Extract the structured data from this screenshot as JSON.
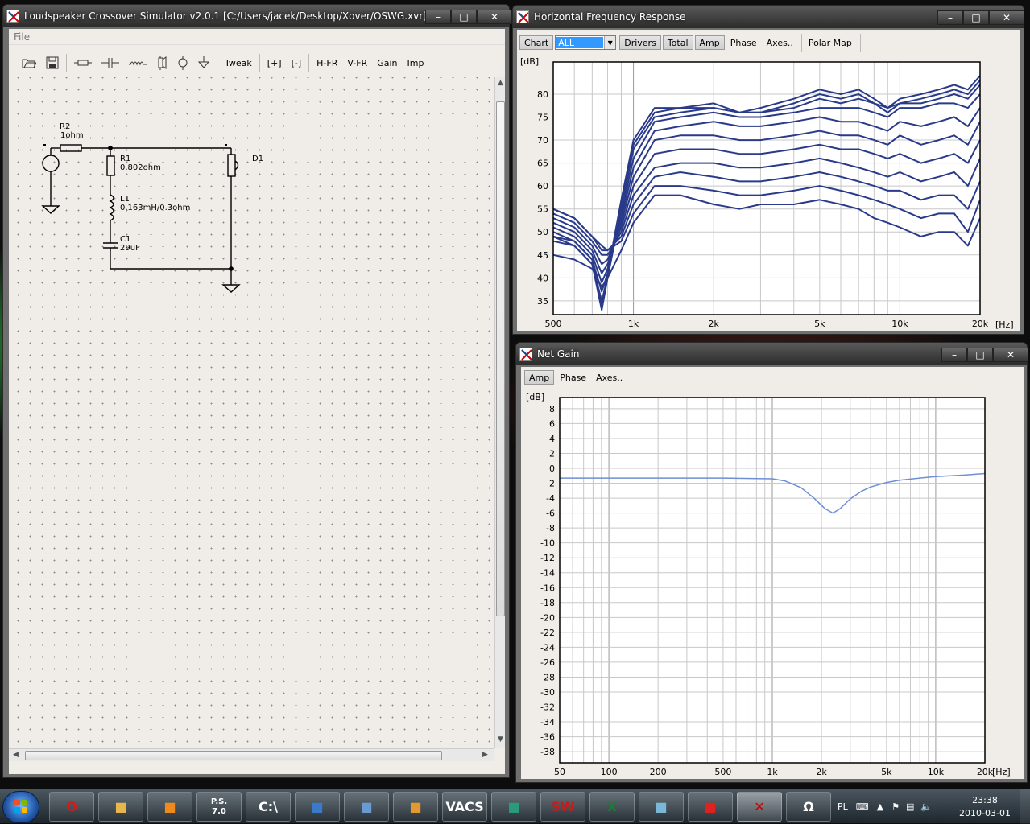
{
  "main_window": {
    "title": "Loudspeaker Crossover Simulator v2.0.1 [C:/Users/jacek/Desktop/Xover/OSWG.xvr]",
    "menu": [
      "File"
    ],
    "toolbar": {
      "open_icon": "folder-open-icon",
      "save_icon": "floppy-disk-icon",
      "component_icons": [
        "resistor-icon",
        "capacitor-icon",
        "inductor-icon",
        "driver-icon",
        "source-icon",
        "ground-icon"
      ],
      "tweak": "Tweak",
      "plus": "[+]",
      "minus": "[-]",
      "hfr": "H-FR",
      "vfr": "V-FR",
      "gain": "Gain",
      "imp": "Imp"
    },
    "schematic": {
      "r2_name": "R2",
      "r2_value": "1ohm",
      "r1_name": "R1",
      "r1_value": "0.802ohm",
      "l1_name": "L1",
      "l1_value": "0.163mH/0.3ohm",
      "c1_name": "C1",
      "c1_value": "29uF",
      "d1_name": "D1"
    }
  },
  "hfr_window": {
    "title": "Horizontal Frequency Response",
    "toolbar": {
      "chart": "Chart",
      "select_value": "ALL",
      "drivers": "Drivers",
      "total": "Total",
      "amp": "Amp",
      "phase": "Phase",
      "axes": "Axes..",
      "polar": "Polar Map"
    },
    "y_unit": "[dB]",
    "x_unit": "[Hz]"
  },
  "gain_window": {
    "title": "Net Gain",
    "toolbar": {
      "amp": "Amp",
      "phase": "Phase",
      "axes": "Axes.."
    },
    "y_unit": "[dB]",
    "x_unit": "[Hz]"
  },
  "chart_data": [
    {
      "type": "line",
      "title": "Horizontal Frequency Response",
      "xlabel": "[Hz]",
      "ylabel": "[dB]",
      "xscale": "log",
      "xlim": [
        500,
        20000
      ],
      "ylim": [
        32,
        87
      ],
      "xticks": [
        500,
        1000,
        2000,
        5000,
        10000,
        20000
      ],
      "xtick_labels": [
        "500",
        "1k",
        "2k",
        "5k",
        "10k",
        "20k"
      ],
      "yticks": [
        35,
        40,
        45,
        50,
        55,
        60,
        65,
        70,
        75,
        80
      ],
      "grid": true,
      "color": "#2a3a8a",
      "x": [
        500,
        600,
        700,
        760,
        800,
        900,
        1000,
        1200,
        1500,
        2000,
        2500,
        3000,
        4000,
        5000,
        6000,
        7000,
        8000,
        9000,
        10000,
        12000,
        14000,
        16000,
        18000,
        20000
      ],
      "series": [
        {
          "values": [
            49,
            48,
            44,
            34,
            41,
            57,
            70,
            77,
            77,
            78,
            76,
            77,
            79,
            81,
            80,
            81,
            79,
            77,
            79,
            80,
            81,
            82,
            81,
            84
          ]
        },
        {
          "values": [
            48,
            47,
            43,
            33,
            40,
            56,
            69,
            76,
            77,
            77,
            76,
            76,
            78,
            80,
            79,
            80,
            78,
            77,
            78,
            79,
            80,
            81,
            80,
            83
          ]
        },
        {
          "values": [
            49,
            47,
            43,
            35,
            40,
            55,
            68,
            75,
            76,
            77,
            76,
            76,
            77,
            79,
            78,
            79,
            78,
            76,
            78,
            78,
            79,
            80,
            79,
            82
          ]
        },
        {
          "values": [
            50,
            48,
            44,
            37,
            41,
            54,
            66,
            74,
            75,
            76,
            75,
            75,
            76,
            77,
            77,
            77,
            76,
            75,
            77,
            77,
            78,
            78,
            77,
            80
          ]
        },
        {
          "values": [
            51,
            49,
            45,
            39,
            42,
            53,
            64,
            72,
            73,
            74,
            73,
            73,
            74,
            75,
            74,
            74,
            73,
            72,
            74,
            73,
            74,
            75,
            73,
            77
          ]
        },
        {
          "values": [
            52,
            50,
            46,
            41,
            43,
            52,
            62,
            70,
            71,
            71,
            70,
            70,
            71,
            72,
            71,
            71,
            70,
            69,
            71,
            69,
            70,
            71,
            69,
            74
          ]
        },
        {
          "values": [
            53,
            51,
            47,
            43,
            44,
            51,
            60,
            67,
            68,
            68,
            67,
            67,
            68,
            69,
            68,
            68,
            67,
            66,
            67,
            65,
            66,
            67,
            65,
            70
          ]
        },
        {
          "values": [
            54,
            52,
            48,
            45,
            45,
            50,
            58,
            64,
            65,
            65,
            64,
            64,
            65,
            66,
            65,
            64,
            63,
            62,
            63,
            61,
            62,
            63,
            60,
            66
          ]
        },
        {
          "values": [
            55,
            53,
            49,
            46,
            46,
            49,
            56,
            62,
            63,
            62,
            61,
            61,
            62,
            63,
            62,
            61,
            60,
            59,
            59,
            57,
            58,
            58,
            55,
            61
          ]
        },
        {
          "values": [
            55,
            53,
            49,
            47,
            46,
            48,
            54,
            60,
            60,
            59,
            58,
            58,
            59,
            60,
            59,
            58,
            57,
            56,
            55,
            53,
            54,
            54,
            50,
            57
          ]
        },
        {
          "values": [
            45,
            44,
            42,
            38,
            40,
            46,
            52,
            58,
            58,
            56,
            55,
            56,
            56,
            57,
            56,
            55,
            53,
            52,
            51,
            49,
            50,
            50,
            47,
            53
          ]
        }
      ]
    },
    {
      "type": "line",
      "title": "Net Gain",
      "xlabel": "[Hz]",
      "ylabel": "[dB]",
      "xscale": "log",
      "xlim": [
        50,
        20000
      ],
      "ylim": [
        -39.5,
        9.5
      ],
      "xticks": [
        50,
        100,
        200,
        500,
        1000,
        2000,
        5000,
        10000,
        20000
      ],
      "xtick_labels": [
        "50",
        "100",
        "200",
        "500",
        "1k",
        "2k",
        "5k",
        "10k",
        "20k"
      ],
      "yticks": [
        8,
        6,
        4,
        2,
        0,
        -2,
        -4,
        -6,
        -8,
        -10,
        -12,
        -14,
        -16,
        -18,
        -20,
        -22,
        -24,
        -26,
        -28,
        -30,
        -32,
        -34,
        -36,
        -38
      ],
      "grid": true,
      "color": "#6e8ed6",
      "x": [
        50,
        100,
        200,
        500,
        1000,
        1200,
        1500,
        1800,
        2100,
        2350,
        2600,
        3000,
        3500,
        4000,
        5000,
        6000,
        8000,
        10000,
        15000,
        20000
      ],
      "series": [
        {
          "values": [
            -1.3,
            -1.3,
            -1.3,
            -1.3,
            -1.4,
            -1.7,
            -2.6,
            -4.0,
            -5.4,
            -6.0,
            -5.4,
            -4.1,
            -3.1,
            -2.5,
            -1.9,
            -1.6,
            -1.3,
            -1.1,
            -0.9,
            -0.7
          ]
        }
      ]
    }
  ],
  "taskbar": {
    "apps": [
      "opera-icon",
      "explorer-folder-icon",
      "media-player-icon",
      "ps-icon",
      "cmd-icon",
      "photo-app-icon",
      "notepad-icon",
      "pen-app-icon",
      "vacs-icon",
      "arc-app-icon",
      "sw-icon",
      "excel-icon",
      "note-icon",
      "refresh-app-icon",
      "xsim-icon",
      "charmap-icon"
    ],
    "app_labels": {
      "ps": "P.S.\n7.0",
      "vacs": "VACS",
      "sw": "SW",
      "charmap": "Ω"
    },
    "lang": "PL",
    "time": "23:38",
    "date": "2010-03-01"
  }
}
